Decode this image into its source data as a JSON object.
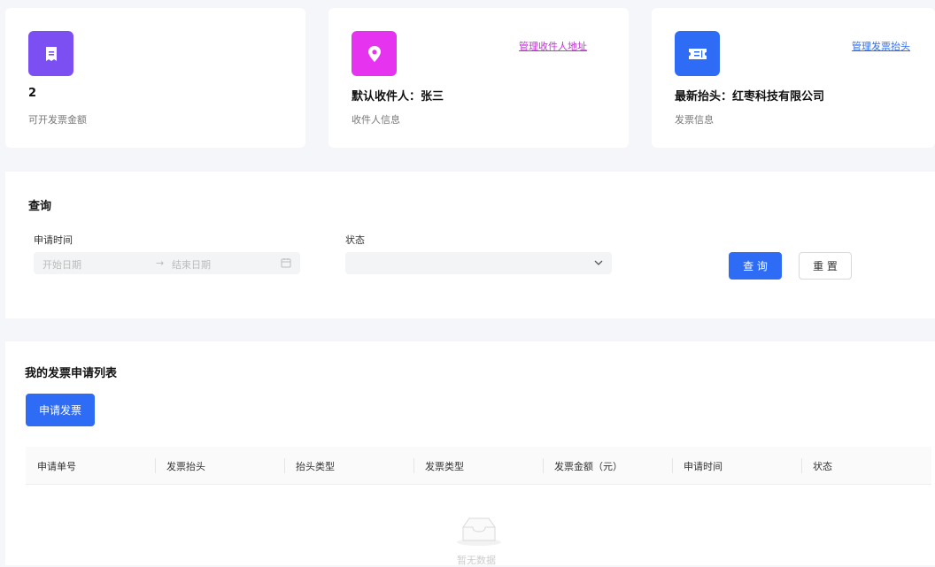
{
  "stats": {
    "invoice_amount": {
      "value": "2",
      "caption": "可开发票金额",
      "icon": "receipt-icon",
      "color": "#7b4ff2"
    },
    "recipient": {
      "value": "默认收件人：张三",
      "caption": "收件人信息",
      "link": "管理收件人地址",
      "icon": "location-pin-icon",
      "color": "#e633f0"
    },
    "header": {
      "value": "最新抬头：红枣科技有限公司",
      "caption": "发票信息",
      "link": "管理发票抬头",
      "icon": "ticket-icon",
      "color": "#2e6cf6"
    }
  },
  "query": {
    "title": "查询",
    "apply_time_label": "申请时间",
    "start_placeholder": "开始日期",
    "end_placeholder": "结束日期",
    "status_label": "状态",
    "search_button": "查 询",
    "reset_button": "重 置"
  },
  "list": {
    "title": "我的发票申请列表",
    "apply_button": "申请发票",
    "columns": [
      "申请单号",
      "发票抬头",
      "抬头类型",
      "发票类型",
      "发票金额（元）",
      "申请时间",
      "状态"
    ],
    "empty_text": "暂无数据"
  }
}
